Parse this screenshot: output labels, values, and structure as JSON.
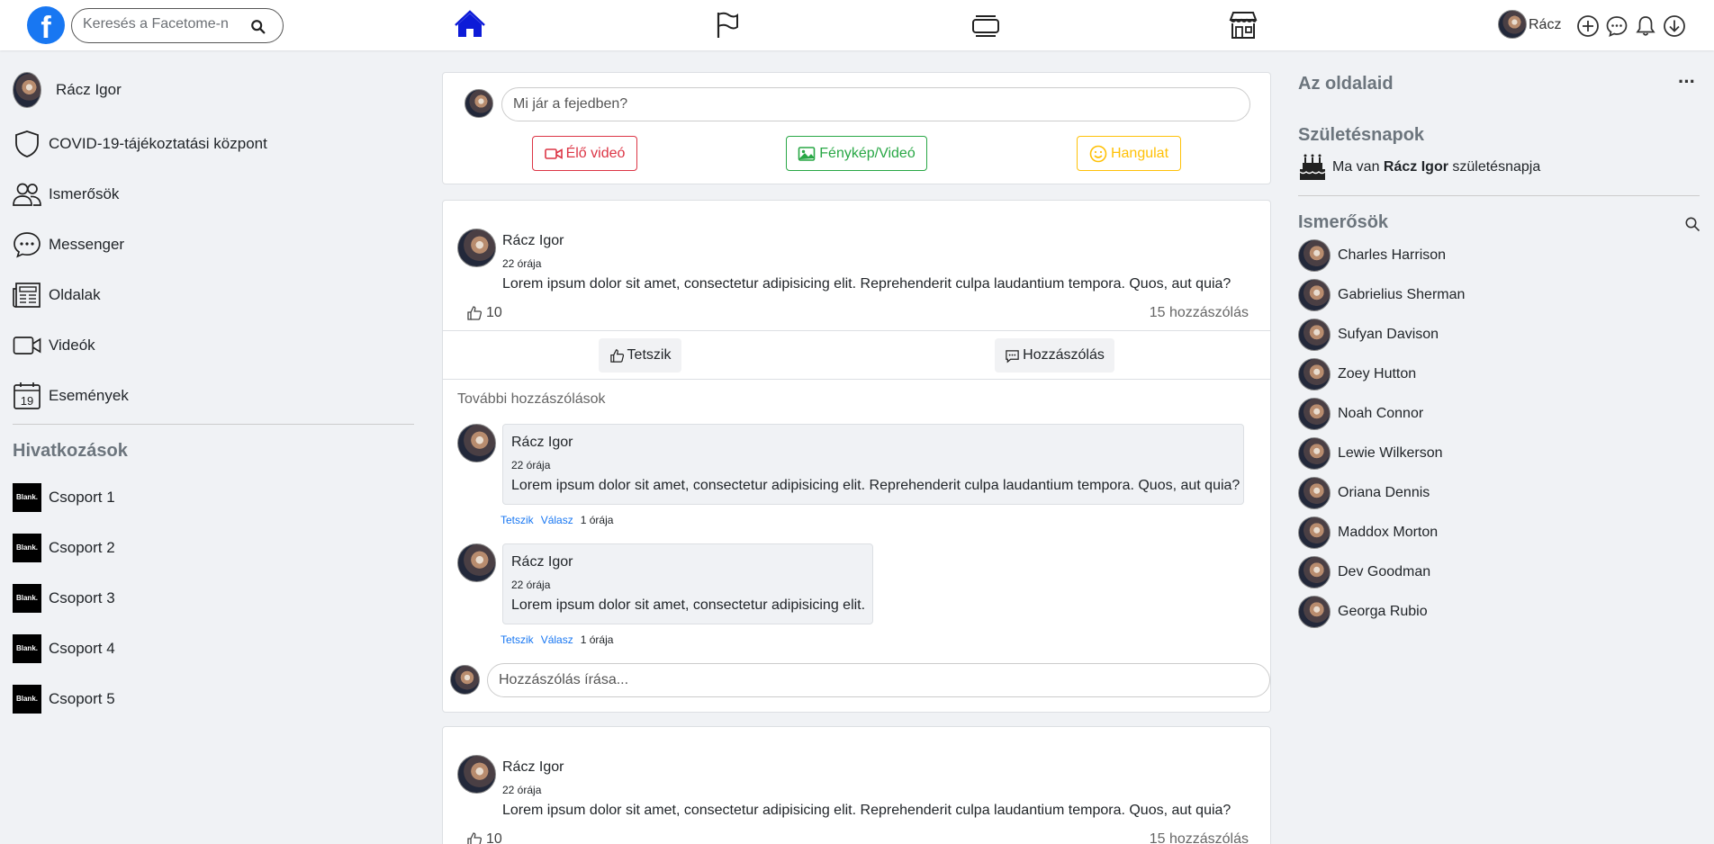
{
  "topbar": {
    "logo_letter": "f",
    "search_placeholder": "Keresés a Facetome-n",
    "nav_icons": [
      "home-icon",
      "flag-icon",
      "watch-icon",
      "marketplace-icon"
    ],
    "profile_name": "Rácz",
    "tool_icons": [
      "plus-circle-icon",
      "messenger-icon",
      "bell-icon",
      "download-icon"
    ],
    "accent": "#1877f2"
  },
  "left": {
    "items": [
      {
        "label": "Rácz Igor",
        "icon": "avatar"
      },
      {
        "label": "COVID-19-tájékoztatási központ",
        "icon": "shield-icon"
      },
      {
        "label": "Ismerősök",
        "icon": "people-icon"
      },
      {
        "label": "Messenger",
        "icon": "chat-icon"
      },
      {
        "label": "Oldalak",
        "icon": "newspaper-icon"
      },
      {
        "label": "Videók",
        "icon": "video-icon"
      },
      {
        "label": "Események",
        "icon": "calendar-icon",
        "icon_text": "19"
      }
    ],
    "shortcuts_title": "Hivatkozások",
    "blank_logo_text": "Blank.",
    "groups": [
      "Csoport 1",
      "Csoport 2",
      "Csoport 3",
      "Csoport 4",
      "Csoport 5"
    ]
  },
  "composer": {
    "placeholder": "Mi jár a fejedben?",
    "live_label": "Élő videó",
    "photo_label": "Fénykép/Videó",
    "mood_label": "Hangulat",
    "colors": {
      "live": "#dc3545",
      "photo": "#28a745",
      "mood": "#ffc107"
    }
  },
  "posts": [
    {
      "author": "Rácz Igor",
      "time": "22 órája",
      "text": "Lorem ipsum dolor sit amet, consectetur adipisicing elit. Reprehenderit culpa laudantium tempora. Quos, aut quia?",
      "likes": "10",
      "comments_count": "15 hozzászólás",
      "like_label": "Tetszik",
      "comment_label": "Hozzászólás",
      "more_comments": "További hozzászólások",
      "comments": [
        {
          "author": "Rácz Igor",
          "time": "22 órája",
          "text": "Lorem ipsum dolor sit amet, consectetur adipisicing elit. Reprehenderit culpa laudantium tempora. Quos, aut quia?",
          "like": "Tetszik",
          "reply": "Válasz",
          "ago": "1 órája"
        },
        {
          "author": "Rácz Igor",
          "time": "22 órája",
          "text": "Lorem ipsum dolor sit amet, consectetur adipisicing elit.",
          "like": "Tetszik",
          "reply": "Válasz",
          "ago": "1 órája"
        }
      ],
      "write_placeholder": "Hozzászólás írása..."
    },
    {
      "author": "Rácz Igor",
      "time": "22 órája",
      "text": "Lorem ipsum dolor sit amet, consectetur adipisicing elit. Reprehenderit culpa laudantium tempora. Quos, aut quia?",
      "likes": "10",
      "comments_count": "15 hozzászólás"
    }
  ],
  "right": {
    "pages_title": "Az oldalaid",
    "menu_dots": "···",
    "birthdays_title": "Születésnapok",
    "birthday_prefix": "Ma van ",
    "birthday_name": "Rácz Igor",
    "birthday_suffix": " születésnapja",
    "friends_title": "Ismerősök",
    "friends": [
      "Charles Harrison",
      "Gabrielius Sherman",
      "Sufyan Davison",
      "Zoey Hutton",
      "Noah Connor",
      "Lewie Wilkerson",
      "Oriana Dennis",
      "Maddox Morton",
      "Dev Goodman",
      "Georga Rubio"
    ]
  }
}
